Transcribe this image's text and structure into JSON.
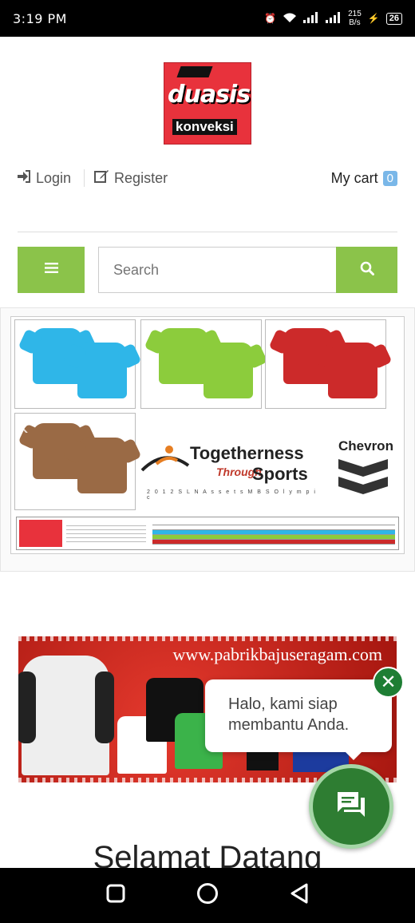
{
  "status_bar": {
    "time": "3:19 PM",
    "speed_top": "215",
    "speed_bottom": "B/s",
    "battery": "26"
  },
  "logo": {
    "line1": "duasisi",
    "line2": "konveksi"
  },
  "auth": {
    "login": "Login",
    "register": "Register",
    "cart_label": "My cart",
    "cart_count": "0"
  },
  "search": {
    "placeholder": "Search"
  },
  "slider": {
    "togetherness": "Togetherness",
    "through": "Through",
    "sports": "Sports",
    "footer": "2 0 1 2 S L N A s s e t s M B S O l y m p i c",
    "chevron": "Chevron",
    "tee_colors": [
      "#2fb6e8",
      "#8ccc3c",
      "#cc2a2a",
      "#9a6a45"
    ]
  },
  "banner": {
    "url": "www.pabrikbajuseragam.com"
  },
  "chat": {
    "message": "Halo, kami siap membantu Anda."
  },
  "welcome": "Selamat Datang",
  "colors": {
    "accent": "#8bc34a",
    "chat_green": "#2e7d32",
    "badge": "#7ab7e8"
  }
}
